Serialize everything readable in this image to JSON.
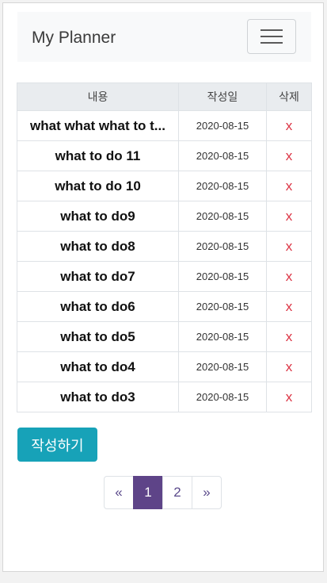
{
  "navbar": {
    "brand": "My Planner",
    "toggle_icon": "hamburger-menu-icon"
  },
  "table": {
    "headers": [
      "내용",
      "작성일",
      "삭제"
    ],
    "rows": [
      {
        "content": "what what what to t...",
        "date": "2020-08-15",
        "delete": "x"
      },
      {
        "content": "what to do 11",
        "date": "2020-08-15",
        "delete": "x"
      },
      {
        "content": "what to do 10",
        "date": "2020-08-15",
        "delete": "x"
      },
      {
        "content": "what to do9",
        "date": "2020-08-15",
        "delete": "x"
      },
      {
        "content": "what to do8",
        "date": "2020-08-15",
        "delete": "x"
      },
      {
        "content": "what to do7",
        "date": "2020-08-15",
        "delete": "x"
      },
      {
        "content": "what to do6",
        "date": "2020-08-15",
        "delete": "x"
      },
      {
        "content": "what to do5",
        "date": "2020-08-15",
        "delete": "x"
      },
      {
        "content": "what to do4",
        "date": "2020-08-15",
        "delete": "x"
      },
      {
        "content": "what to do3",
        "date": "2020-08-15",
        "delete": "x"
      }
    ]
  },
  "write_button": "작성하기",
  "pagination": {
    "prev": "«",
    "pages": [
      "1",
      "2"
    ],
    "active": "1",
    "next": "»"
  },
  "colors": {
    "accent_button": "#17a2b8",
    "active_page": "#5e4488",
    "delete": "#dc3545"
  }
}
